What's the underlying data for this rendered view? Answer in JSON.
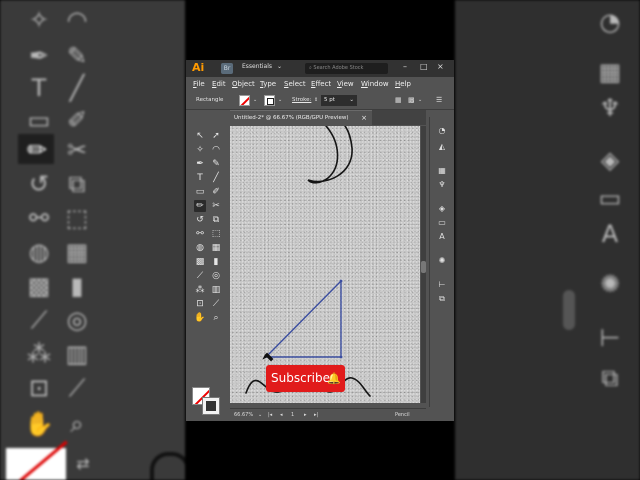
{
  "app": {
    "logo": "Ai",
    "bridge": "Br",
    "workspace": "Essentials",
    "search_placeholder": "Search Adobe Stock",
    "window_buttons": {
      "minimize": "–",
      "maximize": "□",
      "close": "×"
    }
  },
  "menu": [
    "File",
    "Edit",
    "Object",
    "Type",
    "Select",
    "Effect",
    "View",
    "Window",
    "Help"
  ],
  "control_bar": {
    "selection": "Rectangle",
    "stroke_label": "Stroke:",
    "stroke_value": "5 pt"
  },
  "document": {
    "tab_title": "Untitled-2* @ 66.67% (RGB/GPU Preview)",
    "close": "×"
  },
  "status_bar": {
    "zoom": "66.67%",
    "artboard": "1",
    "tool": "Pencil"
  },
  "overlay": {
    "subscribe_label": "Subscribe",
    "subscribe_color": "#e11b1b",
    "bell_icon": "bell-icon"
  },
  "colors": {
    "ui_dark": "#323232",
    "ui_panel": "#535353",
    "ai_orange": "#ff9a00",
    "path_blue": "#3b4ea0"
  },
  "tools": [
    "selection-tool",
    "direct-selection-tool",
    "magic-wand-tool",
    "lasso-tool",
    "pen-tool",
    "curvature-tool",
    "type-tool",
    "line-tool",
    "rectangle-tool",
    "paintbrush-tool",
    "pencil-tool",
    "eraser-tool",
    "rotate-tool",
    "scale-tool",
    "width-tool",
    "free-transform-tool",
    "shape-builder-tool",
    "perspective-grid-tool",
    "mesh-tool",
    "gradient-tool",
    "eyedropper-tool",
    "blend-tool",
    "symbol-sprayer-tool",
    "column-graph-tool",
    "artboard-tool",
    "slice-tool",
    "hand-tool",
    "zoom-tool"
  ]
}
